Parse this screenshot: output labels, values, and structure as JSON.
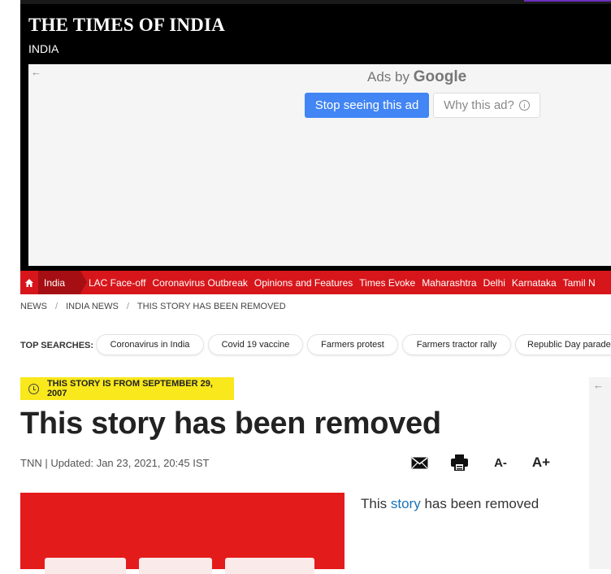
{
  "header": {
    "logo": "THE TIMES OF INDIA",
    "edition": "INDIA"
  },
  "ad": {
    "back_icon": "arrow-left-icon",
    "ads_by": "Ads by",
    "google": "Google",
    "stop_label": "Stop seeing this ad",
    "why_label": "Why this ad?",
    "info_icon": "info-icon"
  },
  "nav": {
    "home_icon": "home-icon",
    "active": "India",
    "links": [
      "LAC Face-off",
      "Coronavirus Outbreak",
      "Opinions and Features",
      "Times Evoke",
      "Maharashtra",
      "Delhi",
      "Karnataka",
      "Tamil N"
    ]
  },
  "breadcrumb": {
    "items": [
      "NEWS",
      "INDIA NEWS",
      "THIS STORY HAS BEEN REMOVED"
    ],
    "separator": "/"
  },
  "top_searches": {
    "label": "TOP SEARCHES:",
    "chips": [
      "Coronavirus in India",
      "Covid 19 vaccine",
      "Farmers protest",
      "Farmers tractor rally",
      "Republic Day parade"
    ]
  },
  "article": {
    "badge": "THIS STORY IS FROM SEPTEMBER 29, 2007",
    "headline": "This story has been removed",
    "byline": "TNN | Updated: Jan 23, 2021, 20:45 IST",
    "tools": {
      "email_icon": "email-icon",
      "print_icon": "print-icon",
      "decrease": "A-",
      "increase": "A+"
    },
    "body_prefix": "This",
    "body_link": "story",
    "body_suffix": "has been removed"
  },
  "colors": {
    "nav_red": "#d7161b",
    "nav_active": "#a50f13",
    "badge_yellow": "#f8e81c",
    "ad_button_blue": "#4285f4",
    "link_blue": "#1a73b8"
  }
}
